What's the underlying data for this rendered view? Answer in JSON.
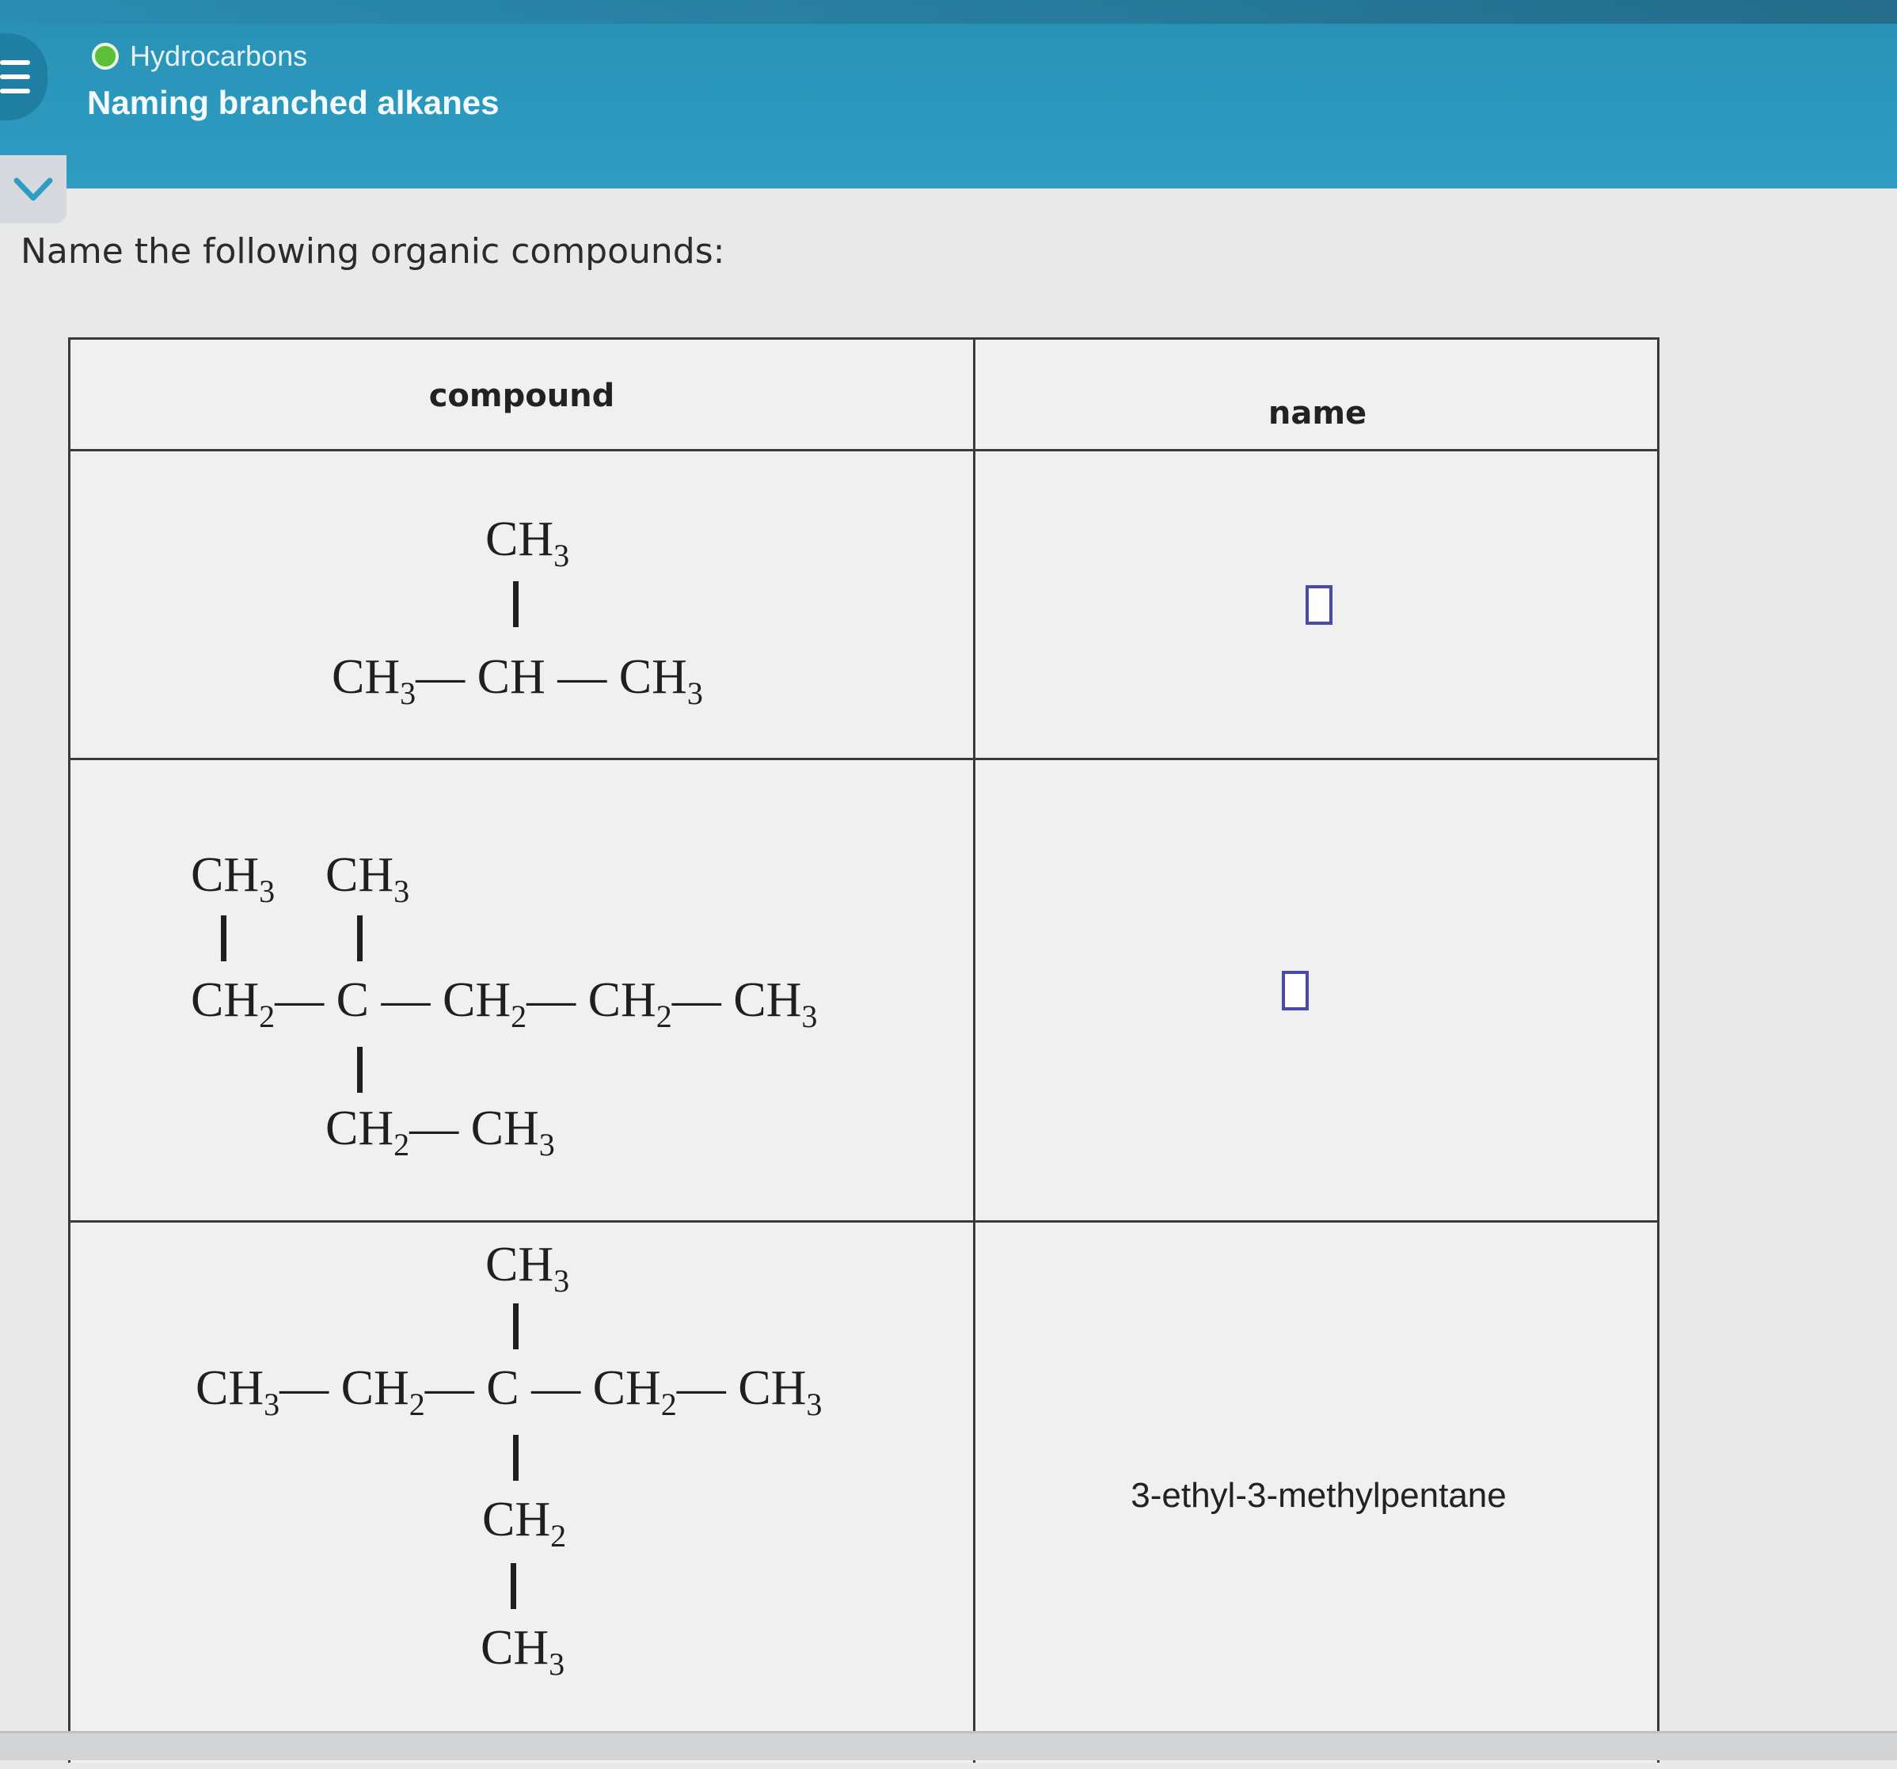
{
  "header": {
    "topic": "Hydrocarbons",
    "title": "Naming branched alkanes"
  },
  "prompt": "Name the following organic compounds:",
  "table": {
    "col_compound": "compound",
    "col_name": "name"
  },
  "rows": [
    {
      "formula_lines": {
        "top": "CH",
        "main_a": "CH",
        "main_b": "CH",
        "main_c": "CH"
      },
      "answer": ""
    },
    {
      "formula_lines": {},
      "answer": ""
    },
    {
      "formula_lines": {},
      "answer": "3-ethyl-3-methylpentane"
    }
  ],
  "colors": {
    "header": "#2b96bb",
    "status_dot": "#5cbf3a",
    "answer_box_border": "#4a4aa8"
  },
  "icons": {
    "menu": "hamburger-icon",
    "status": "status-dot-icon",
    "collapse": "chevron-down-icon"
  }
}
